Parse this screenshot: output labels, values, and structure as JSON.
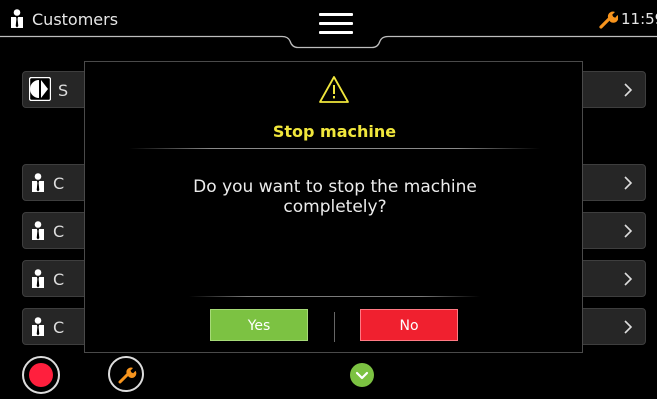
{
  "header": {
    "title": "Customers",
    "time": "11:59",
    "icons": {
      "person": "person-icon",
      "menu": "hamburger-icon",
      "service": "wrench-icon"
    }
  },
  "list": {
    "rows": [
      {
        "label": "S",
        "icon": "brand-logo-icon"
      },
      {
        "label": "",
        "icon": "none"
      },
      {
        "label": "C",
        "icon": "person-icon"
      },
      {
        "label": "C",
        "icon": "person-icon"
      },
      {
        "label": "C",
        "icon": "person-icon"
      },
      {
        "label": "C",
        "icon": "person-icon"
      }
    ]
  },
  "dialog": {
    "title": "Stop machine",
    "message": "Do you want to stop the machine completely?",
    "yes_label": "Yes",
    "no_label": "No",
    "icon": "warning-icon"
  },
  "footer": {
    "stop": "stop-icon",
    "tools": "wrench-icon",
    "more": "chevron-down-icon"
  },
  "colors": {
    "accent_yellow": "#f0e63c",
    "yes_green": "#7cc242",
    "no_red": "#f0202f",
    "stop_red": "#ff1f3d",
    "wrench_orange": "#f7941d"
  }
}
